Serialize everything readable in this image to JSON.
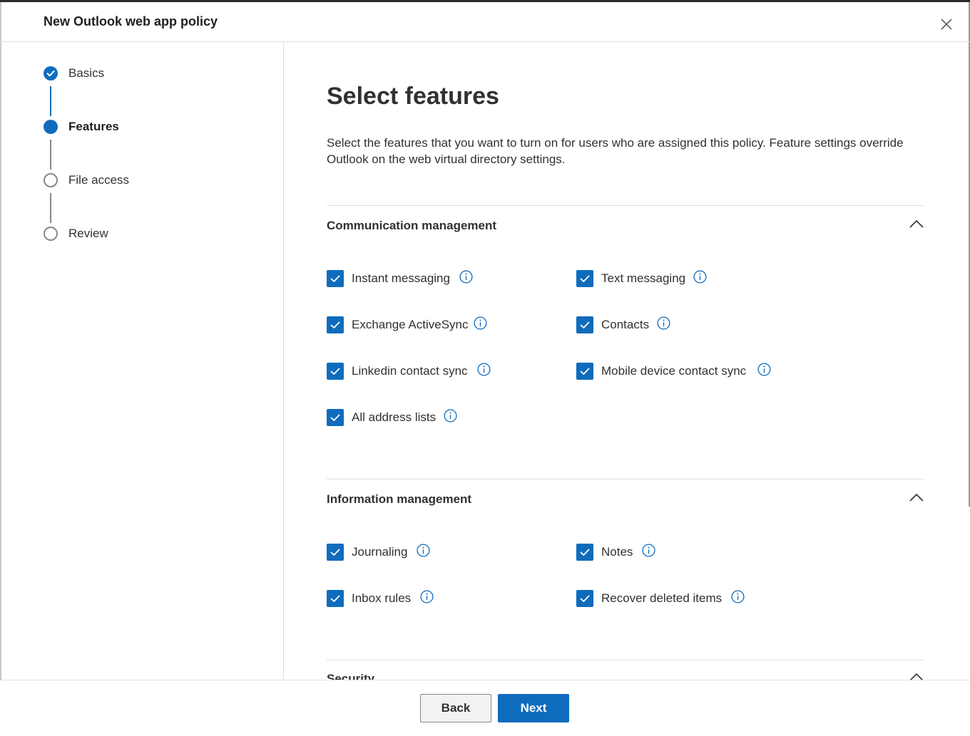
{
  "header": {
    "title": "New Outlook web app policy"
  },
  "steps": [
    {
      "label": "Basics",
      "state": "done"
    },
    {
      "label": "Features",
      "state": "current"
    },
    {
      "label": "File access",
      "state": "todo"
    },
    {
      "label": "Review",
      "state": "todo"
    }
  ],
  "main": {
    "title": "Select features",
    "description": "Select the features that you want to turn on for users who are assigned this policy. Feature settings override Outlook on the web virtual directory settings."
  },
  "sections": [
    {
      "title": "Communication management",
      "expanded": true,
      "items": [
        {
          "label": "Instant messaging",
          "checked": true
        },
        {
          "label": "Text messaging",
          "checked": true
        },
        {
          "label": "Exchange ActiveSync",
          "checked": true
        },
        {
          "label": "Contacts",
          "checked": true
        },
        {
          "label": "Linkedin contact sync",
          "checked": true
        },
        {
          "label": "Mobile device contact sync",
          "checked": true
        },
        {
          "label": "All address lists",
          "checked": true
        }
      ]
    },
    {
      "title": "Information management",
      "expanded": true,
      "items": [
        {
          "label": "Journaling",
          "checked": true
        },
        {
          "label": "Notes",
          "checked": true
        },
        {
          "label": "Inbox rules",
          "checked": true
        },
        {
          "label": "Recover deleted items",
          "checked": true
        }
      ]
    },
    {
      "title": "Security",
      "expanded": true,
      "items": []
    }
  ],
  "footer": {
    "back_label": "Back",
    "next_label": "Next"
  },
  "colors": {
    "accent": "#0f6cbd",
    "text": "#323130",
    "border": "#e1dfdd"
  }
}
